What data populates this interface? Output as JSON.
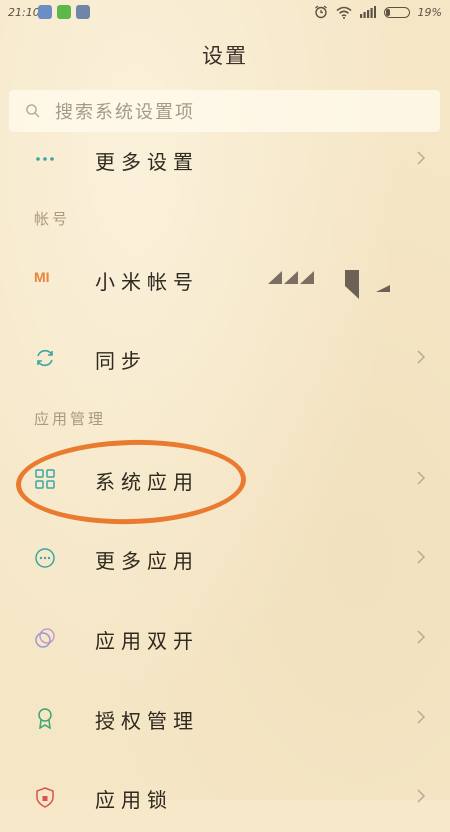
{
  "status_bar": {
    "time": "21:10",
    "battery_text": "19%",
    "battery_level": 0.19,
    "notification_icons": [
      "shield-app-icon",
      "green-app-icon",
      "calculator-app-icon"
    ],
    "right_icons": [
      "alarm-icon",
      "wifi-icon",
      "signal-icon",
      "battery-icon"
    ]
  },
  "header": {
    "title": "设置"
  },
  "search": {
    "placeholder": "搜索系统设置项"
  },
  "rows": {
    "more_settings": "更多设置",
    "xiaomi_account": "小米帐号",
    "sync": "同步",
    "system_apps": "系统应用",
    "more_apps": "更多应用",
    "dual_apps": "应用双开",
    "permissions": "授权管理",
    "app_lock": "应用锁"
  },
  "sections": {
    "account": "帐号",
    "app_management": "应用管理"
  },
  "icons": {
    "mi_logo_text": "MI"
  },
  "colors": {
    "background": "#f5e6c6",
    "accent_teal": "#3aa6a4",
    "mi_orange": "#e9833a",
    "annotation_orange": "#ea7a2f"
  }
}
